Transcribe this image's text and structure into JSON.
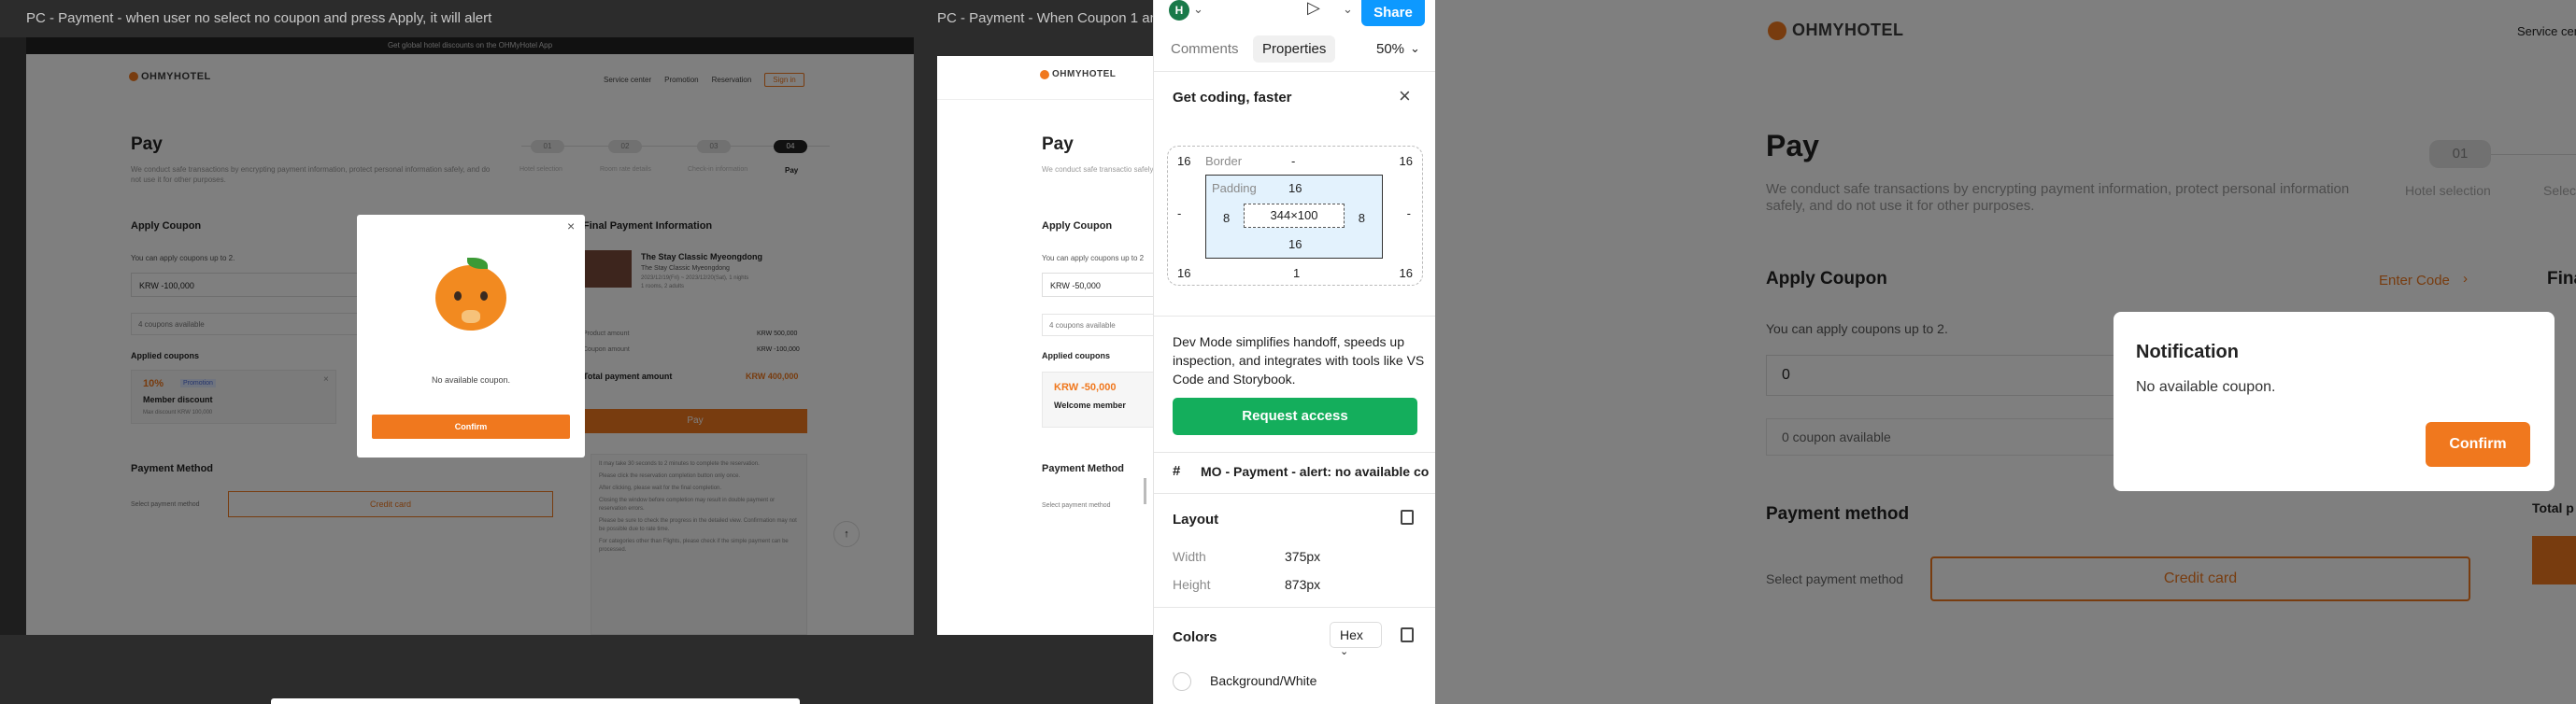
{
  "frames": {
    "frame1_title": "PC - Payment - when user no select no coupon and press Apply, it will alert",
    "frame2_title": "PC - Payment -  When Coupon 1 an"
  },
  "site": {
    "logo": "OHMYHOTEL",
    "banner": "Get global hotel discounts on the OHMyHotel App",
    "nav": [
      "Service center",
      "Promotion",
      "Reservation"
    ],
    "signin": "Sign in",
    "pay_title": "Pay",
    "pay_desc": "We conduct safe transactions by encrypting payment information, protect personal information safely, and do not use it for other purposes.",
    "pay_desc_short": "We conduct safe transactio safely, and do not use it fo",
    "steps": [
      {
        "num": "01",
        "label": "Hotel selection"
      },
      {
        "num": "02",
        "label": "Room rate details"
      },
      {
        "num": "03",
        "label": "Check-in information"
      },
      {
        "num": "04",
        "label": "Pay"
      }
    ],
    "apply_coupon": "Apply Coupon",
    "enter_code": "Enter Code ›",
    "coupon_note": "You can apply coupons up to 2.",
    "coupon_note_short": "You can apply coupons up to 2",
    "coupon_input": "KRW -100,000",
    "coupon_input2": "KRW -50,000",
    "coupons_available": "4 coupons available",
    "applied_coupons": "Applied coupons",
    "member_pct": "10%",
    "member_badge": "Promotion",
    "member_discount": "Member discount",
    "member_max": "Max discount KRW 100,000",
    "welcome_amount": "KRW -50,000",
    "welcome_member": "Welcome member",
    "payment_method": "Payment Method",
    "select_payment": "Select payment method",
    "credit_card": "Credit card",
    "final_info": "Final Payment Information",
    "hotel_name": "The Stay Classic Myeongdong",
    "hotel_sub": "The Stay Classic Myeongdong",
    "hotel_dates": "2023/12/19(Fri) ~ 2023/12/20(Sat), 1 nights",
    "hotel_rooms": "1 rooms, 2 adults",
    "product_amount_label": "Product amount",
    "product_amount": "KRW 500,000",
    "coupon_amount_label": "Coupon amount",
    "coupon_amount": "KRW -100,000",
    "total_label": "Total payment amount",
    "total_amount": "KRW 400,000",
    "pay_button": "Pay",
    "notes": [
      "It may take 30 seconds to 2 minutes to complete the reservation.",
      "Please click the reservation completion button only once.",
      "After clicking, please wait for the final completion.",
      "Closing the window before completion may result in double payment or reservation errors.",
      "Please be sure to check the progress in the detailed view. Confirmation may not be possible due to rate time.",
      "For categories other than Flights, please check if the simple payment can be processed."
    ]
  },
  "modal1": {
    "message": "No available coupon.",
    "confirm": "Confirm"
  },
  "right_frame": {
    "logo": "OHMYHOTEL",
    "service_center": "Service cen",
    "pay_title": "Pay",
    "pay_desc1": "We conduct safe transactions by encrypting payment information, protect personal information",
    "pay_desc2": "safely, and do not use it for other purposes.",
    "step_num": "01",
    "step_label": "Hotel selection",
    "step_label2": "Selec",
    "apply_coupon": "Apply Coupon",
    "enter_code": "Enter Code",
    "final_short": "Final",
    "coupon_note": "You can apply coupons up to 2.",
    "input_value": "0",
    "coupon_available": "0 coupon available",
    "payment_method": "Payment method",
    "select_payment": "Select payment method",
    "credit_card": "Credit card",
    "total_short": "Total p"
  },
  "notification": {
    "title": "Notification",
    "message": "No available coupon.",
    "confirm": "Confirm"
  },
  "figma": {
    "avatar_letter": "H",
    "share": "Share",
    "tab_comments": "Comments",
    "tab_properties": "Properties",
    "zoom": "50%",
    "get_coding": "Get coding, faster",
    "box": {
      "margin_left": "16",
      "margin_right": "16",
      "margin_top_left": "16",
      "margin_top_right": "16",
      "border_label": "Border",
      "border_value": "-",
      "padding_label": "Padding",
      "padding_top": "16",
      "padding_left": "8",
      "padding_right": "8",
      "padding_bottom": "16",
      "content": "344×100",
      "outer_left": "-",
      "outer_right": "-",
      "bottom_left": "16",
      "bottom_center": "1",
      "bottom_right": "16"
    },
    "devmode_text": "Dev Mode simplifies handoff, speeds up inspection, and integrates with tools like VS Code and Storybook.",
    "request_access": "Request access",
    "layer_name": "MO - Payment - alert: no available co",
    "layout": "Layout",
    "width_label": "Width",
    "width_value": "375px",
    "height_label": "Height",
    "height_value": "873px",
    "colors": "Colors",
    "hex": "Hex",
    "color_name": "Background/White"
  }
}
